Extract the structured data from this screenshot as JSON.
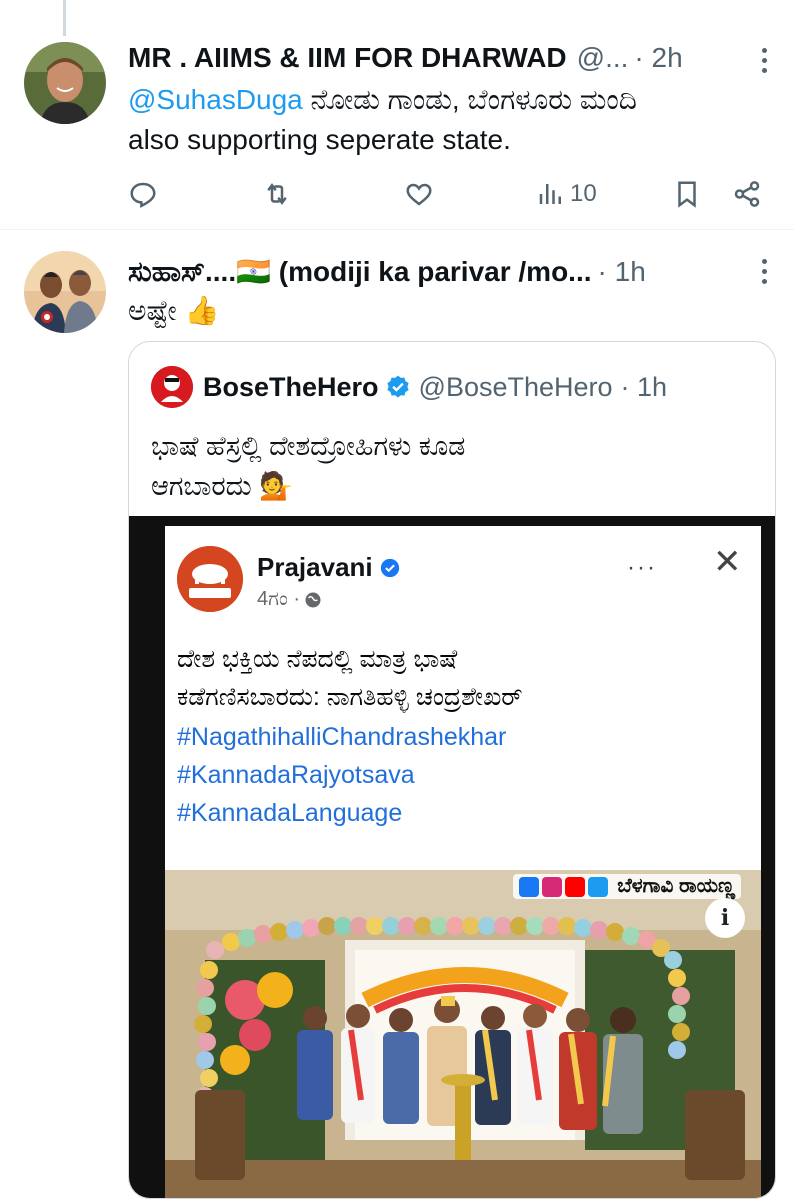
{
  "tweets": [
    {
      "name": "MR . AIIMS & IIM FOR DHARWAD",
      "handle": "@...",
      "time": "· 2h",
      "mention": "@SuhasDuga",
      "text_after_mention": " ನೋಡು ಗಾಂಡು, ಬೆಂಗಳೂರು ಮಂದಿ",
      "text_line2": "also supporting seperate state.",
      "views": "10",
      "icons": [
        "reply-icon",
        "retweet-icon",
        "like-icon",
        "views-icon",
        "bookmark-icon",
        "share-icon"
      ]
    },
    {
      "name": "ಸುಹಾಸ್....🇮🇳 (modiji ka parivar /mo...",
      "time": "· 1h",
      "text": "ಅಷ್ಟೇ 👍",
      "quote": {
        "name": "BoseTheHero",
        "handle": "@BoseTheHero",
        "time": "· 1h",
        "text_line1": "ಭಾಷೆ ಹೆಸ್ರಲ್ಲಿ ದೇಶದ್ರೋಹಿಗಳು ಕೂಡ",
        "text_line2": "ಆಗಬಾರದು 💁",
        "image": {
          "page_name": "Prajavani",
          "meta": "4ಗಂ ·",
          "dots": "···",
          "close": "✕",
          "line1": "ದೇಶ ಭಕ್ತಿಯ ನೆಪದಲ್ಲಿ ಮಾತ್ರ ಭಾಷೆ",
          "line2": "ಕಡೆಗಣಿಸಬಾರದು: ನಾಗತಿಹಳ್ಳಿ ಚಂದ್ರಶೇಖರ್",
          "hashtags": [
            "#NagathihalliChandrashekhar",
            "#KannadaRajyotsava",
            "#KannadaLanguage"
          ],
          "watermark": "ಬೆಳಗಾವಿ ರಾಯಣ್ಣ",
          "info": "i"
        }
      }
    }
  ],
  "colors": {
    "link": "#1d9bf0",
    "secondary": "#536471",
    "verified": "#1d9bf0",
    "fb_link": "#216fdb"
  }
}
